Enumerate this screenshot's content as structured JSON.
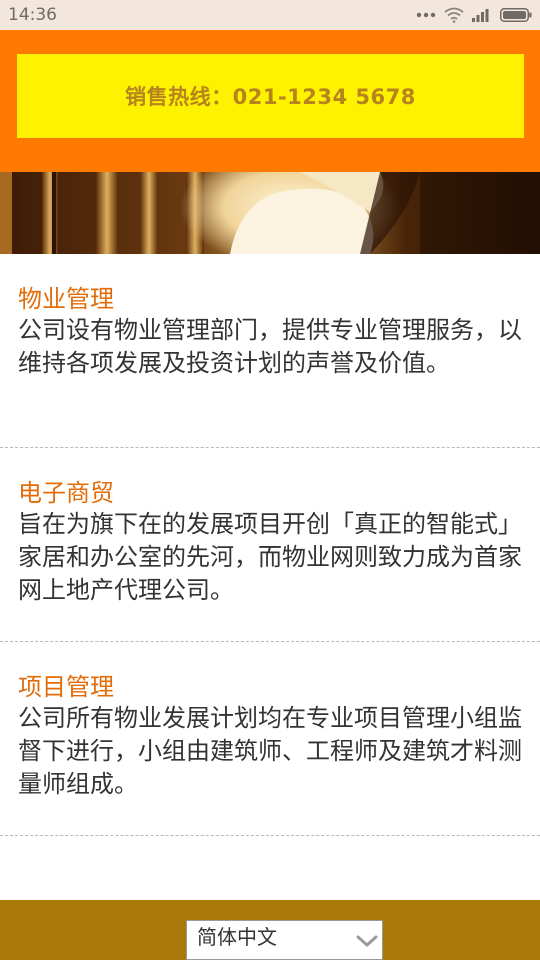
{
  "status_bar": {
    "time": "14:36",
    "icons": [
      "more-dots-icon",
      "wifi-icon",
      "signal-icon",
      "battery-icon"
    ]
  },
  "hotline": {
    "text": "销售热线：021-1234 5678"
  },
  "sections": [
    {
      "title": "物业管理",
      "body": "公司设有物业管理部门，提供专业管理服务，以维持各项发展及投资计划的声誉及价值。"
    },
    {
      "title": "电子商贸",
      "body": "旨在为旗下在的发展项目开创「真正的智能式」家居和办公室的先河，而物业网则致力成为首家网上地产代理公司。"
    },
    {
      "title": "项目管理",
      "body": "公司所有物业发展计划均在专业项目管理小组监督下进行，小组由建筑师、工程师及建筑才料测量师组成。"
    }
  ],
  "footer": {
    "language_selected": "简体中文"
  },
  "colors": {
    "banner_orange": "#ff7a00",
    "hotline_yellow": "#fff200",
    "section_title": "#e36c0a",
    "footer_bg": "#a87809"
  }
}
